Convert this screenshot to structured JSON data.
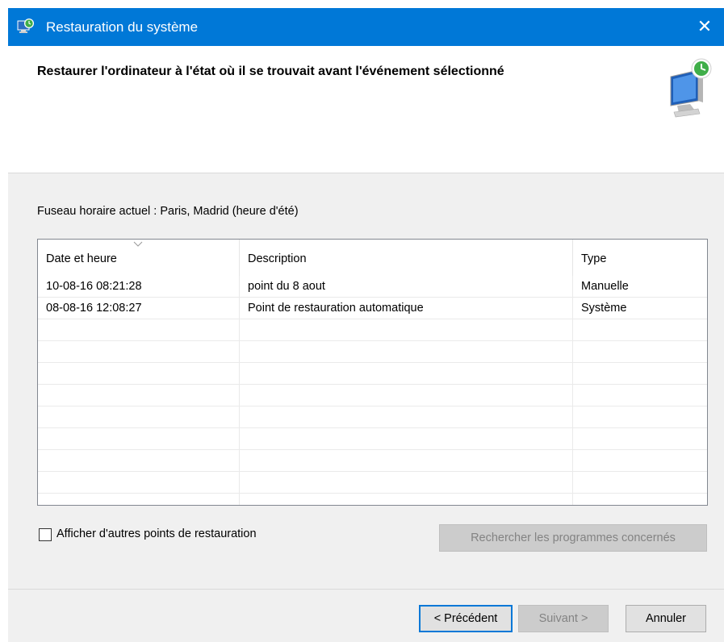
{
  "window": {
    "title": "Restauration du système",
    "close_glyph": "✕"
  },
  "header": {
    "heading": "Restaurer l'ordinateur à l'état où il se trouvait avant l'événement sélectionné",
    "icon": "system-restore-monitor-icon"
  },
  "timezone_text": "Fuseau horaire actuel : Paris, Madrid (heure d'été)",
  "table": {
    "columns": [
      "Date et heure",
      "Description",
      "Type"
    ],
    "sort_column": "Date et heure",
    "rows": [
      {
        "date": "10-08-16 08:21:28",
        "description": "point du 8 aout",
        "type": "Manuelle"
      },
      {
        "date": "08-08-16 12:08:27",
        "description": "Point de restauration automatique",
        "type": "Système"
      }
    ],
    "empty_rows": 8
  },
  "show_more": {
    "label": "Afficher d'autres points de restauration",
    "checked": false
  },
  "buttons": {
    "search": "Rechercher les programmes concernés",
    "prev": "< Précédent",
    "next": "Suivant >",
    "cancel": "Annuler"
  },
  "colors": {
    "titlebar": "#0078d7",
    "dialog_bg": "#f0f0f0",
    "disabled_text": "#838383"
  }
}
